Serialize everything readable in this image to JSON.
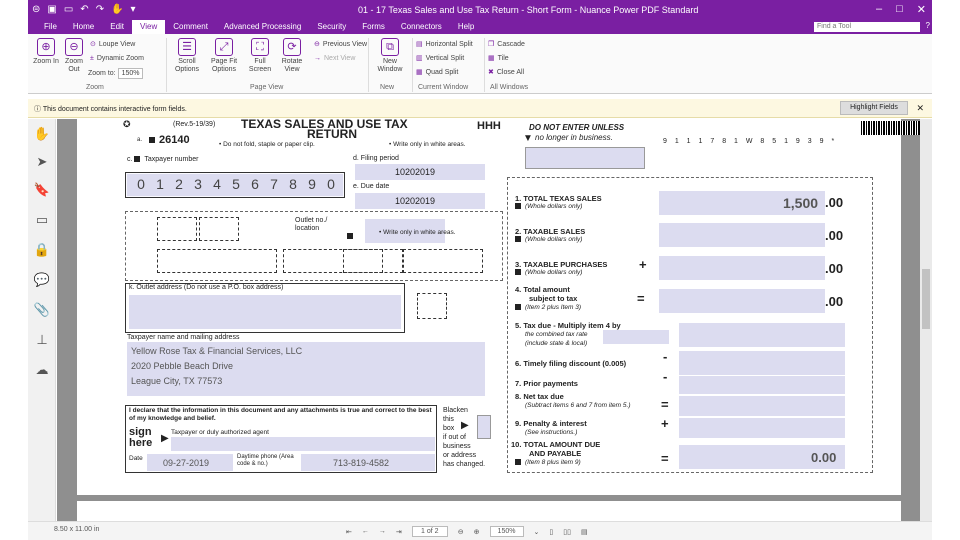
{
  "window": {
    "title": "01 - 17 Texas Sales and Use Tax Return - Short Form - Nuance Power PDF Standard",
    "menu_tabs": [
      "File",
      "Home",
      "Edit",
      "View",
      "Comment",
      "Advanced Processing",
      "Security",
      "Forms",
      "Connectors",
      "Help"
    ],
    "active_tab": "View",
    "find_placeholder": "Find a Tool"
  },
  "ribbon": {
    "zoom_in": "Zoom In",
    "zoom_out": "Zoom Out",
    "loupe": "Loupe View",
    "dynamic_zoom": "Dynamic Zoom",
    "zoom_to": "Zoom to:",
    "zoom_value": "150%",
    "scroll_options": "Scroll Options",
    "page_fit_options": "Page Fit Options",
    "full_screen": "Full Screen",
    "rotate_view": "Rotate View",
    "previous_view": "Previous View",
    "next_view": "Next View",
    "new_window": "New Window",
    "horizontal_split": "Horizontal Split",
    "vertical_split": "Vertical Split",
    "quad_split": "Quad Split",
    "cascade": "Cascade",
    "tile": "Tile",
    "close_all": "Close All",
    "groups": [
      "Zoom",
      "Page View",
      "New",
      "Current Window",
      "All Windows"
    ]
  },
  "infobar": {
    "message": "This document contains interactive form fields.",
    "highlight_button": "Highlight Fields"
  },
  "status": {
    "page_size": "8.50 x 11.00 in",
    "page_indicator": "1 of 2",
    "zoom": "150%"
  },
  "form": {
    "header": {
      "rev": "(Rev.5-19/39)",
      "title_line1": "TEXAS SALES AND USE TAX",
      "title_line2": "RETURN",
      "form_code": "HHH",
      "form_number": "26140",
      "no_fold": "Do not fold, staple or paper clip.",
      "white_areas": "Write only in white areas.",
      "out_of_business_line1": "DO NOT ENTER UNLESS",
      "out_of_business_line2": "no longer in business.",
      "barcode_digits": "9 1 1 1 7 8 1 W 8 5 1 9 3 9 *"
    },
    "taxpayer_number_label": "Taxpayer number",
    "taxpayer_digits": [
      "0",
      "1",
      "2",
      "3",
      "4",
      "5",
      "6",
      "7",
      "8",
      "9",
      "0"
    ],
    "filing_period_label": "Filing period",
    "filing_period": "10202019",
    "due_date_label": "Due date",
    "due_date": "10202019",
    "outlet_no_label": "Outlet no./ location",
    "outlet_address_label": "Outlet address (Do not use a P.O. box address)",
    "taxpayer_name_label": "Taxpayer name and mailing address",
    "mailing": [
      "Yellow Rose Tax & Financial Services, LLC",
      "2020 Pebble Beach Drive",
      "League City, TX  77573"
    ],
    "declaration": "I declare that the information in this document and any attachments is true and correct to the best of my knowledge and belief.",
    "sign_here": "sign here",
    "authorized_agent": "Taxpayer or duly authorized agent",
    "date_label": "Date",
    "date_value": "09-27-2019",
    "daytime_phone_label": "Daytime phone (Area code & no.)",
    "phone_value": "713-819-4582",
    "blacken_box": [
      "Blacken",
      "this",
      "box",
      "if out of",
      "business",
      "or address",
      "has changed."
    ],
    "lines": {
      "l1_title": "1. TOTAL TEXAS SALES",
      "l1_sub": "(Whole dollars only)",
      "l1_value": "1,500",
      "l2_title": "2. TAXABLE SALES",
      "l2_sub": "(Whole dollars only)",
      "l3_title": "3. TAXABLE PURCHASES",
      "l3_sub": "(Whole dollars only)",
      "l4_title": "4. Total amount",
      "l4_title2": "subject to tax",
      "l4_sub": "(Item 2 plus Item 3)",
      "l5_title": "5. Tax due - Multiply item 4 by",
      "l5_sub1": "the combined tax rate",
      "l5_sub2": "(include state & local)",
      "l6_title": "6. Timely filing discount (0.005)",
      "l7_title": "7. Prior payments",
      "l8_title": "8. Net tax due",
      "l8_sub": "(Subtract items 6 and 7 from item 5.)",
      "l9_title": "9. Penalty & interest",
      "l9_sub": "(See instructions.)",
      "l10_title": "10. TOTAL AMOUNT DUE",
      "l10_title2": "AND PAYABLE",
      "l10_sub": "(Item 8 plus item 9)",
      "l10_value": "0.00",
      "cents": ".00",
      "plus": "+",
      "equals": "=",
      "minus": "-"
    }
  }
}
